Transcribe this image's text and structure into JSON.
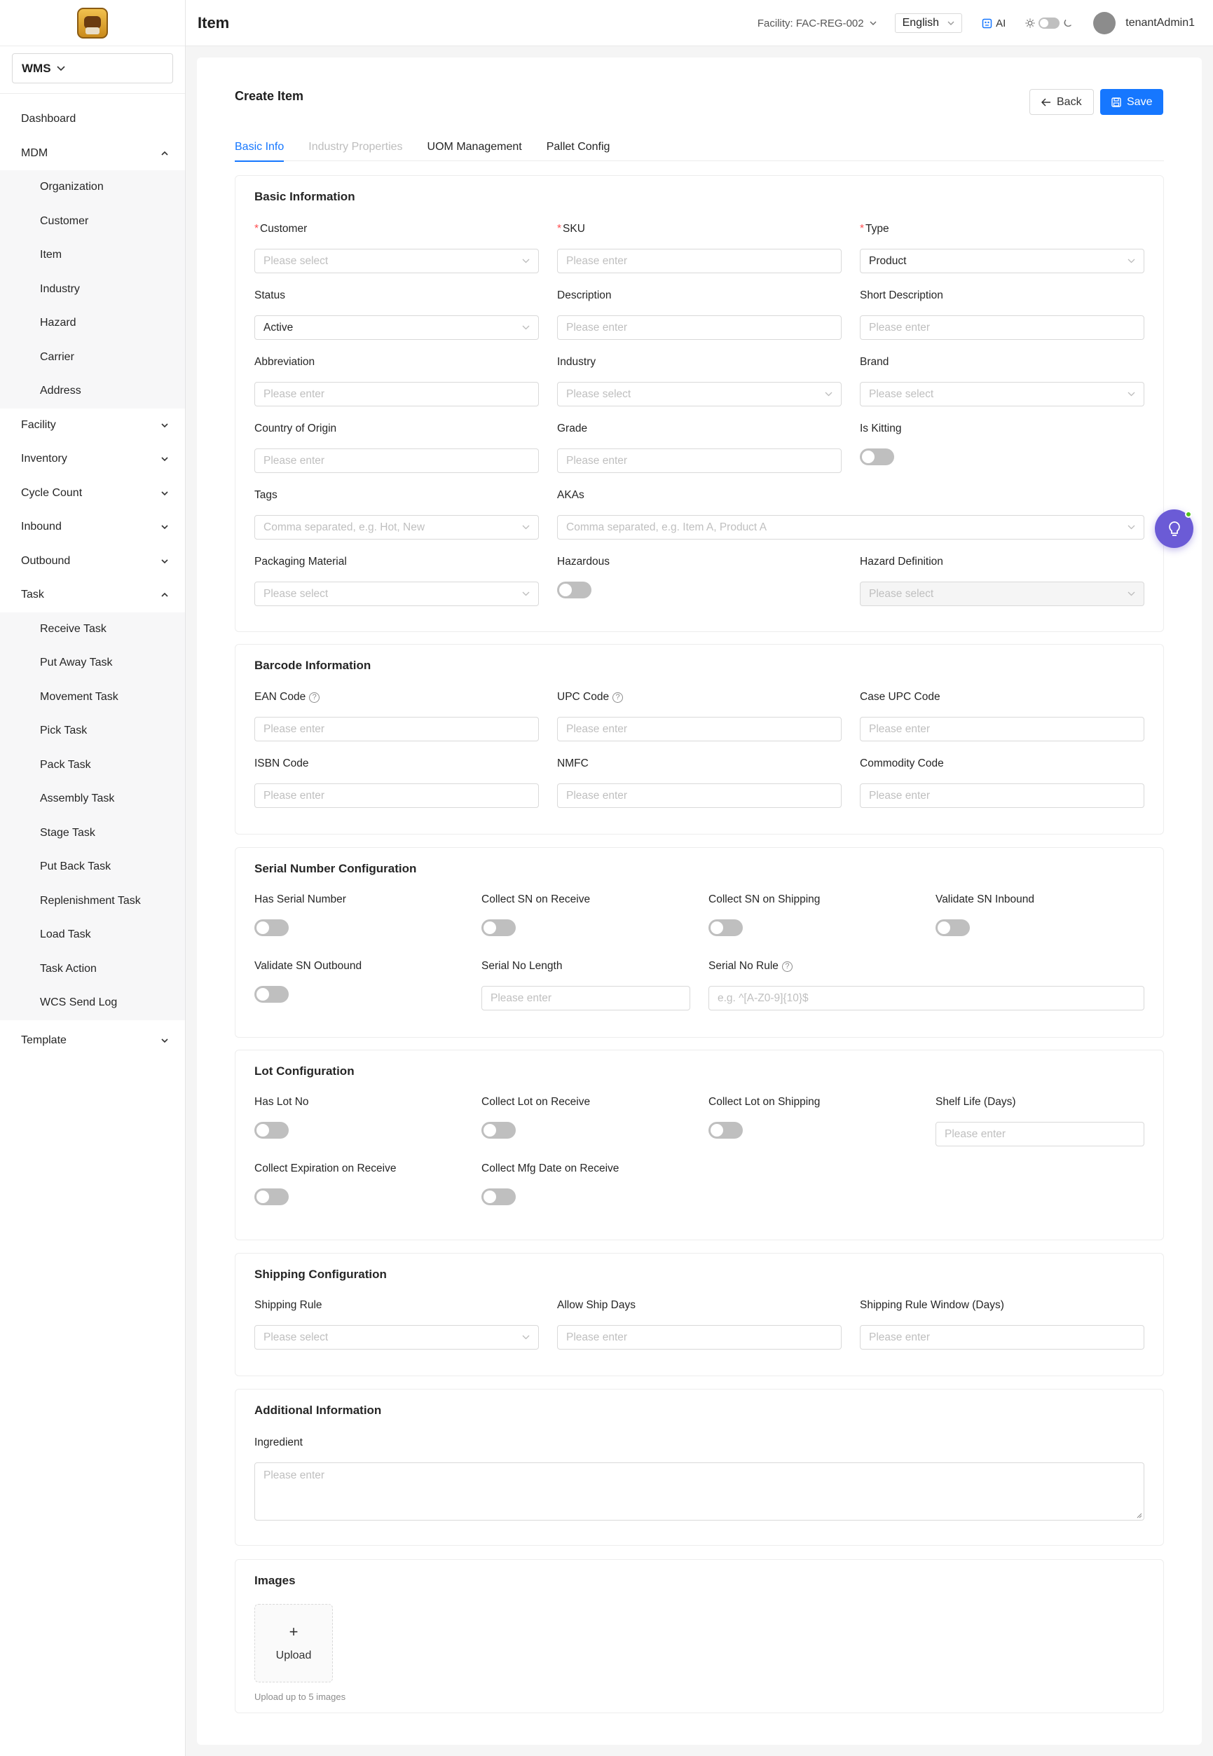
{
  "app": {
    "workspace": "WMS",
    "page_title": "Item"
  },
  "sidebar": {
    "items": [
      {
        "label": "Dashboard"
      },
      {
        "label": "MDM",
        "expanded": true,
        "children": [
          "Organization",
          "Customer",
          "Item",
          "Industry",
          "Hazard",
          "Carrier",
          "Address"
        ]
      },
      {
        "label": "Facility"
      },
      {
        "label": "Inventory"
      },
      {
        "label": "Cycle Count"
      },
      {
        "label": "Inbound"
      },
      {
        "label": "Outbound"
      },
      {
        "label": "Task",
        "expanded": true,
        "children": [
          "Receive Task",
          "Put Away Task",
          "Movement Task",
          "Pick Task",
          "Pack Task",
          "Assembly Task",
          "Stage Task",
          "Put Back Task",
          "Replenishment Task",
          "Load Task",
          "Task Action",
          "WCS Send Log"
        ]
      },
      {
        "label": "Template"
      }
    ]
  },
  "topbar": {
    "facility": "Facility: FAC-REG-002",
    "language": "English",
    "ai_label": "AI",
    "user": "tenantAdmin1"
  },
  "form": {
    "title": "Create Item",
    "back_label": "Back",
    "save_label": "Save",
    "tabs": [
      "Basic Info",
      "Industry Properties",
      "UOM Management",
      "Pallet Config"
    ],
    "basic": {
      "title": "Basic Information",
      "customer": {
        "label": "Customer",
        "placeholder": "Please select"
      },
      "sku": {
        "label": "SKU",
        "placeholder": "Please enter"
      },
      "type": {
        "label": "Type",
        "value": "Product"
      },
      "status": {
        "label": "Status",
        "value": "Active"
      },
      "description": {
        "label": "Description",
        "placeholder": "Please enter"
      },
      "short_description": {
        "label": "Short Description",
        "placeholder": "Please enter"
      },
      "abbreviation": {
        "label": "Abbreviation",
        "placeholder": "Please enter"
      },
      "industry": {
        "label": "Industry",
        "placeholder": "Please select"
      },
      "brand": {
        "label": "Brand",
        "placeholder": "Please select"
      },
      "country": {
        "label": "Country of Origin",
        "placeholder": "Please enter"
      },
      "grade": {
        "label": "Grade",
        "placeholder": "Please enter"
      },
      "is_kitting": {
        "label": "Is Kitting"
      },
      "tags": {
        "label": "Tags",
        "placeholder": "Comma separated, e.g. Hot, New"
      },
      "akas": {
        "label": "AKAs",
        "placeholder": "Comma separated, e.g. Item A, Product A"
      },
      "packaging": {
        "label": "Packaging Material",
        "placeholder": "Please select"
      },
      "hazardous": {
        "label": "Hazardous"
      },
      "hazard_definition": {
        "label": "Hazard Definition",
        "placeholder": "Please select"
      }
    },
    "barcode": {
      "title": "Barcode Information",
      "ean": {
        "label": "EAN Code",
        "placeholder": "Please enter"
      },
      "upc": {
        "label": "UPC Code",
        "placeholder": "Please enter"
      },
      "case_upc": {
        "label": "Case UPC Code",
        "placeholder": "Please enter"
      },
      "isbn": {
        "label": "ISBN Code",
        "placeholder": "Please enter"
      },
      "nmfc": {
        "label": "NMFC",
        "placeholder": "Please enter"
      },
      "commodity": {
        "label": "Commodity Code",
        "placeholder": "Please enter"
      }
    },
    "serial": {
      "title": "Serial Number Configuration",
      "has_sn": "Has Serial Number",
      "collect_receive": "Collect SN on Receive",
      "collect_shipping": "Collect SN on Shipping",
      "validate_inbound": "Validate SN Inbound",
      "validate_outbound": "Validate SN Outbound",
      "length": {
        "label": "Serial No Length",
        "placeholder": "Please enter"
      },
      "rule": {
        "label": "Serial No Rule",
        "placeholder": "e.g. ^[A-Z0-9]{10}$"
      }
    },
    "lot": {
      "title": "Lot Configuration",
      "has_lot": "Has Lot No",
      "collect_receive": "Collect Lot on Receive",
      "collect_shipping": "Collect Lot on Shipping",
      "shelf_life": {
        "label": "Shelf Life (Days)",
        "placeholder": "Please enter"
      },
      "collect_expiration": "Collect Expiration on Receive",
      "collect_mfg": "Collect Mfg Date on Receive"
    },
    "shipping": {
      "title": "Shipping Configuration",
      "rule": {
        "label": "Shipping Rule",
        "placeholder": "Please select"
      },
      "allow_days": {
        "label": "Allow Ship Days",
        "placeholder": "Please enter"
      },
      "window": {
        "label": "Shipping Rule Window (Days)",
        "placeholder": "Please enter"
      }
    },
    "additional": {
      "title": "Additional Information",
      "ingredient": {
        "label": "Ingredient",
        "placeholder": "Please enter"
      }
    },
    "images": {
      "title": "Images",
      "upload_plus": "+",
      "upload_label": "Upload",
      "hint": "Upload up to 5 images"
    }
  },
  "colors": {
    "primary": "#1677ff",
    "assistant": "#6b5bd6"
  }
}
